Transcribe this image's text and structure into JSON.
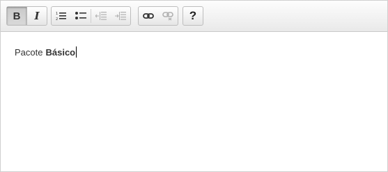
{
  "toolbar": {
    "bold_label": "B",
    "italic_label": "I",
    "help_label": "?",
    "icons": {
      "bold": "bold-icon",
      "italic": "italic-icon",
      "ordered_list": "ordered-list-icon",
      "unordered_list": "bullet-list-icon",
      "outdent": "outdent-icon",
      "indent": "indent-icon",
      "link": "link-icon",
      "unlink": "unlink-icon",
      "help": "help-icon"
    },
    "active": "bold"
  },
  "content": {
    "plain_text": "Pacote",
    "bold_text": "Básico"
  },
  "colors": {
    "icon": "#333333",
    "icon_disabled": "#b0b0b0",
    "border": "#bdbdbd"
  }
}
